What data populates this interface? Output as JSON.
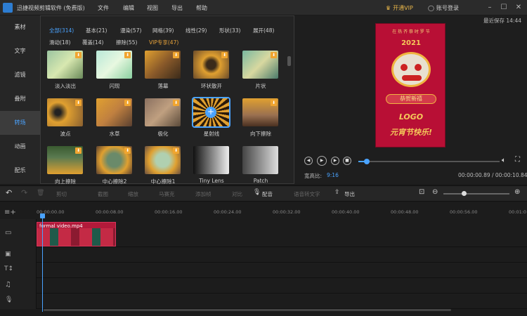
{
  "app": {
    "title": "迅捷视频剪辑软件 (免费版)",
    "menu": [
      "文件",
      "编辑",
      "视图",
      "导出",
      "帮助"
    ],
    "vip": "开通VIP",
    "login": "账号登录",
    "saved": "最近保存 14:44"
  },
  "nav": {
    "items": [
      "素材",
      "文字",
      "滤镜",
      "叠附",
      "转场",
      "动画",
      "配乐"
    ],
    "active_index": 4
  },
  "transitions": {
    "tabs": [
      {
        "label": "全部(314)",
        "active": true
      },
      {
        "label": "基本(21)"
      },
      {
        "label": "漫染(57)"
      },
      {
        "label": "网格(39)"
      },
      {
        "label": "线性(29)"
      },
      {
        "label": "形状(33)"
      },
      {
        "label": "展开(48)"
      },
      {
        "label": "滑动(18)"
      },
      {
        "label": "覆盖(14)"
      },
      {
        "label": "擦除(55)"
      },
      {
        "label": "VIP专享(47)",
        "vip": true
      }
    ],
    "items": [
      {
        "label": "淡入淡出",
        "style": "fade"
      },
      {
        "label": "闪现",
        "style": "flash"
      },
      {
        "label": "落幕",
        "style": "curtain"
      },
      {
        "label": "环状散开",
        "style": "ring"
      },
      {
        "label": "片状",
        "style": "shard"
      },
      {
        "label": "波点",
        "style": "dots"
      },
      {
        "label": "水草",
        "style": "grass"
      },
      {
        "label": "极化",
        "style": "polar"
      },
      {
        "label": "星射线",
        "style": "star",
        "selected": true
      },
      {
        "label": "向下擦除",
        "style": "wipedown"
      },
      {
        "label": "向上擦除",
        "style": "wipeup"
      },
      {
        "label": "中心擦除2",
        "style": "center2"
      },
      {
        "label": "中心擦除1",
        "style": "center1"
      },
      {
        "label": "Tiny Lens",
        "style": "lens"
      },
      {
        "label": "Patch",
        "style": "patch"
      }
    ],
    "download_badge": "⬇"
  },
  "preview": {
    "poster": {
      "top_text": "在 热 齐 祭 时 罗 节",
      "year": "2021",
      "banner": "恭贺新禧",
      "logo": "LOGO",
      "bottom": "元宵节快乐!"
    },
    "aspect_label": "宽高比:",
    "aspect_value": "9:16",
    "time": "00:00:00.89 / 00:00:10.84",
    "progress": 0.06
  },
  "toolbar": {
    "items": [
      "剪切",
      "截图",
      "缩放",
      "马赛克",
      "添加帧",
      "对比",
      "配音",
      "语音转文字",
      "导出"
    ]
  },
  "timeline": {
    "ticks": [
      "00:00:00.00",
      "00:00:08.00",
      "00:00:16.00",
      "00:00:24.00",
      "00:00:32.00",
      "00:00:40.00",
      "00:00:48.00",
      "00:00:56.00",
      "00:01:0"
    ],
    "clip_name": "formal video.mp4"
  },
  "colors": {
    "accent": "#4aa3ff",
    "vip": "#e8a33a",
    "poster": "#b80f35"
  }
}
